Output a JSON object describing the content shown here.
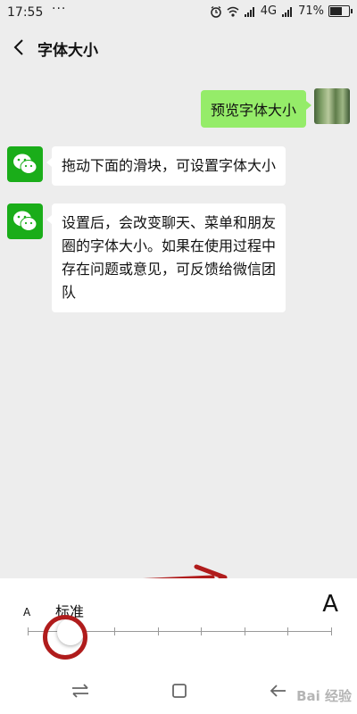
{
  "status_bar": {
    "time": "17:55",
    "dots": "···",
    "network": "4G",
    "battery": "71%",
    "battery_level": 0.71
  },
  "header": {
    "title": "字体大小",
    "back_icon": "chevron-left-icon"
  },
  "messages": [
    {
      "side": "right",
      "text": "预览字体大小"
    },
    {
      "side": "left",
      "text": "拖动下面的滑块，可设置字体大小"
    },
    {
      "side": "left",
      "lines": [
        "设置后，会改变聊天、菜单和朋友",
        "圈的字体大小。如果在使用过程中",
        "存在问题或意见，可反馈给微信团",
        "队"
      ]
    }
  ],
  "font_slider": {
    "small_label": "A",
    "large_label": "A",
    "current_label": "标准",
    "steps": 8,
    "selected_step": 1
  },
  "nav_bar": {
    "watermark": "Bai 经验"
  },
  "colors": {
    "background": "#ededed",
    "own_bubble": "#95ec69",
    "wechat_green": "#1aad19",
    "annotation_red": "#b01c1c"
  }
}
